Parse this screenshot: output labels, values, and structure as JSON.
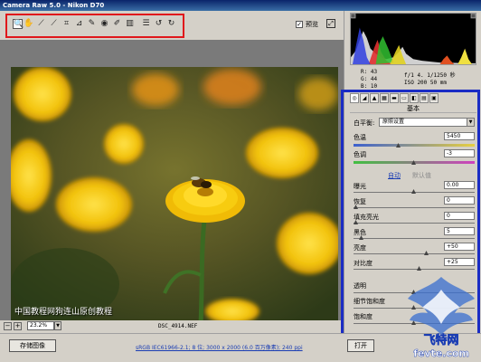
{
  "window": {
    "title": "Camera Raw 5.0 - Nikon D70"
  },
  "toolbar": {
    "tools": [
      {
        "name": "zoom-tool",
        "glyph": "🔍"
      },
      {
        "name": "hand-tool",
        "glyph": "✋"
      },
      {
        "name": "white-balance-tool",
        "glyph": "⟋"
      },
      {
        "name": "color-sampler-tool",
        "glyph": "⟋"
      },
      {
        "name": "crop-tool",
        "glyph": "⌗"
      },
      {
        "name": "straighten-tool",
        "glyph": "⊿"
      },
      {
        "name": "retouch-tool",
        "glyph": "✎"
      },
      {
        "name": "red-eye-tool",
        "glyph": "◉"
      },
      {
        "name": "adjustment-brush-tool",
        "glyph": "✐"
      },
      {
        "name": "graduated-filter-tool",
        "glyph": "▥"
      },
      {
        "name": "preferences-tool",
        "glyph": "☰"
      },
      {
        "name": "rotate-left-tool",
        "glyph": "↺"
      },
      {
        "name": "rotate-right-tool",
        "glyph": "↻"
      }
    ],
    "preview_label": "预览",
    "preview_checked": true
  },
  "canvas": {
    "watermark": "中国教程网狗连山原创教程"
  },
  "status": {
    "zoom_minus": "−",
    "zoom_plus": "+",
    "zoom_value": "23.2%",
    "filename": "DSC_4914.NEF"
  },
  "readout": {
    "r": "R:  43",
    "g": "G:  44",
    "b": "B:  10",
    "aperture": "f/1 4.  1/1250 秒",
    "iso": "ISO 200  50 mm"
  },
  "panel": {
    "title": "基本",
    "white_balance_label": "白平衡:",
    "white_balance_value": "原照设置",
    "temperature_label": "色温",
    "temperature_value": "5450",
    "tint_label": "色调",
    "tint_value": "-3",
    "auto_label": "自动",
    "default_label": "默认值",
    "exposure_label": "曝光",
    "exposure_value": "0.00",
    "recovery_label": "恢复",
    "recovery_value": "0",
    "fill_light_label": "填充亮光",
    "fill_light_value": "0",
    "blacks_label": "黑色",
    "blacks_value": "5",
    "brightness_label": "亮度",
    "brightness_value": "+50",
    "contrast_label": "对比度",
    "contrast_value": "+25",
    "clarity_label": "透明",
    "vibrance_label": "细节饱和度",
    "saturation_label": "饱和度"
  },
  "bottom": {
    "save_label": "存储图像",
    "workflow_text": "sRGB IEC61966-2.1; 8 位; 3000 x 2000 (6.0 百万像素); 240 ppi",
    "open_label": "打开"
  },
  "logo": {
    "text": "飞特网",
    "sub": "fevte.com"
  },
  "colors": {
    "highlight_red": "#e0181b",
    "highlight_blue": "#1a2cc4",
    "flower_yellow": "#f2c20a"
  }
}
